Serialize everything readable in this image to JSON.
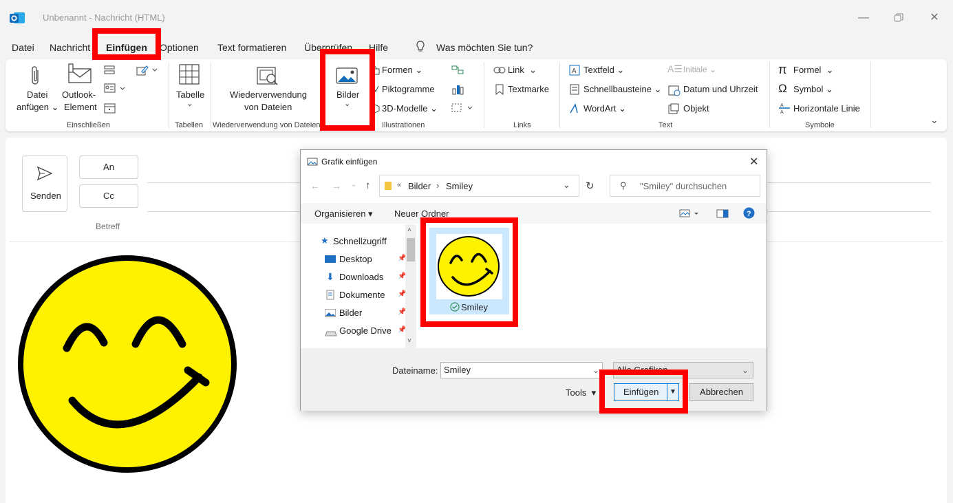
{
  "window": {
    "title": "Unbenannt - Nachricht (HTML)"
  },
  "menu": {
    "tabs": [
      "Datei",
      "Nachricht",
      "Einfügen",
      "Optionen",
      "Text formatieren",
      "Überprüfen",
      "Hilfe"
    ],
    "active_tab": "Einfügen",
    "search": "Was möchten Sie tun?"
  },
  "ribbon": {
    "attach_file": [
      "Datei",
      "anfügen"
    ],
    "outlook_item": [
      "Outlook-",
      "Element"
    ],
    "table": "Tabelle",
    "reuse_files": [
      "Wiederverwendung",
      "von Dateien"
    ],
    "pictures": "Bilder",
    "shapes": "Formen",
    "icons": "Piktogramme",
    "models3d": "3D-Modelle",
    "link": "Link",
    "bookmark": "Textmarke",
    "textbox": "Textfeld",
    "quickparts": "Schnellbausteine",
    "wordart": "WordArt",
    "dropcap": "Initiale",
    "datetime": "Datum und Uhrzeit",
    "object": "Objekt",
    "equation": "Formel",
    "symbol": "Symbol",
    "hline": "Horizontale Linie",
    "groups": {
      "include": "Einschließen",
      "tables": "Tabellen",
      "reuse": "Wiederverwendung von Dateien",
      "illustrations": "Illustrationen",
      "links": "Links",
      "text": "Text",
      "symbols": "Symbole"
    }
  },
  "compose": {
    "send": "Senden",
    "to": "An",
    "cc": "Cc",
    "subject": "Betreff"
  },
  "dialog": {
    "title": "Grafik einfügen",
    "path": [
      "Bilder",
      "Smiley"
    ],
    "search_placeholder": "\"Smiley\" durchsuchen",
    "organize": "Organisieren",
    "new_folder": "Neuer Ordner",
    "nav": [
      "Schnellzugriff",
      "Desktop",
      "Downloads",
      "Dokumente",
      "Bilder",
      "Google Drive"
    ],
    "file": "Smiley",
    "filename_label": "Dateiname:",
    "filename_value": "Smiley",
    "filetype": "Alle Grafiken",
    "tools": "Tools",
    "insert": "Einfügen",
    "cancel": "Abbrechen"
  },
  "colors": {
    "accent": "#0f6cbd",
    "highlight": "#ff0000",
    "smiley": "#fff200"
  }
}
